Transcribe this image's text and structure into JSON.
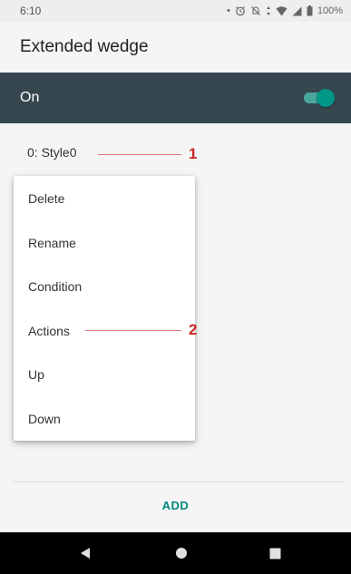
{
  "status_bar": {
    "time": "6:10",
    "battery": "100%",
    "icons": [
      "alarm-icon",
      "mute-icon",
      "data-icon",
      "wifi-icon",
      "signal-icon",
      "battery-icon"
    ]
  },
  "app_bar": {
    "title": "Extended wedge"
  },
  "switch_bar": {
    "label": "On",
    "checked": true,
    "accent_color": "#009688",
    "background_color": "#37474f"
  },
  "list": {
    "items": [
      {
        "label": "0: Style0"
      }
    ]
  },
  "popup_menu": {
    "items": [
      {
        "label": "Delete"
      },
      {
        "label": "Rename"
      },
      {
        "label": "Condition"
      },
      {
        "label": "Actions"
      },
      {
        "label": "Up"
      },
      {
        "label": "Down"
      }
    ]
  },
  "annotations": [
    {
      "number": "1",
      "color": "#c62828"
    },
    {
      "number": "2",
      "color": "#c62828"
    }
  ],
  "footer": {
    "add_label": "ADD"
  },
  "nav_bar": {
    "buttons": [
      "back-icon",
      "home-icon",
      "recents-icon"
    ]
  }
}
